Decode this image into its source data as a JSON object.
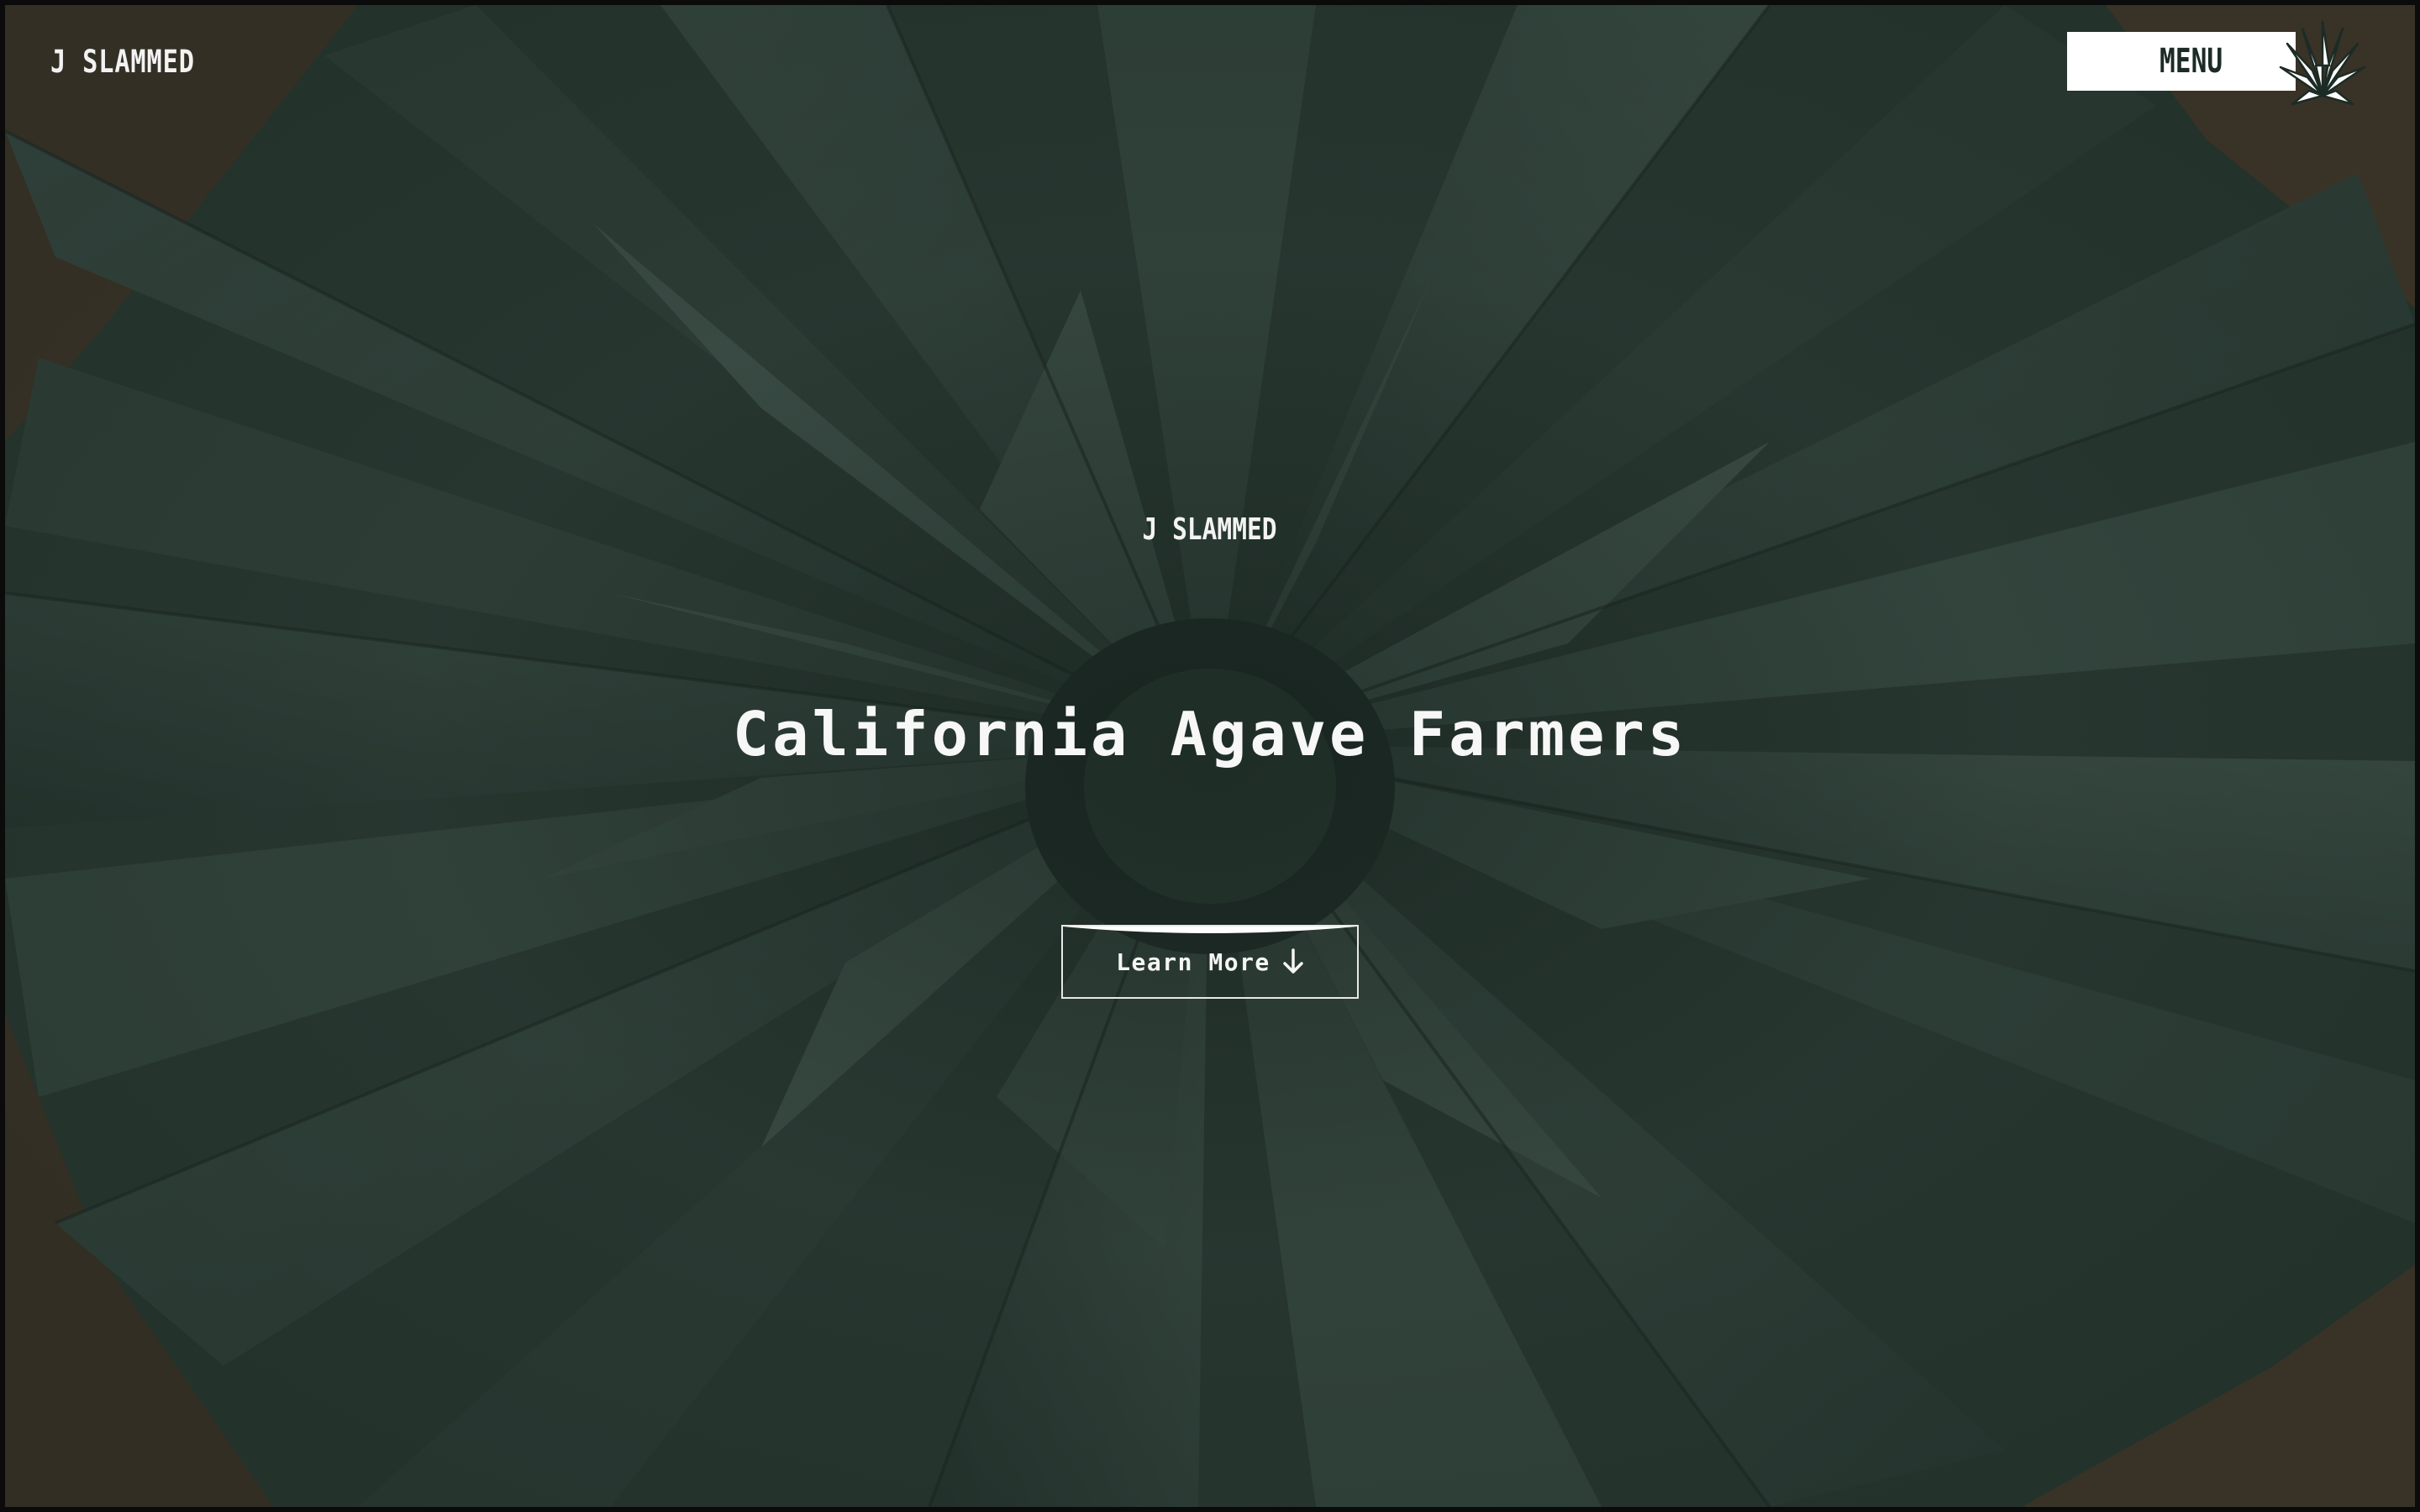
{
  "header": {
    "logo_text": "J SLAMMED",
    "menu_label": "MENU",
    "menu_icon": "agave-icon"
  },
  "hero": {
    "brand": "J SLAMMED",
    "title": "California Agave Farmers",
    "cta_label": "Learn More",
    "cta_icon": "arrow-down-icon"
  },
  "colors": {
    "overlay": "#1c2b25",
    "leaf": "#4e675d",
    "soil": "#6b4a33",
    "text": "#f5f5f5",
    "menu_bg": "#ffffff"
  }
}
